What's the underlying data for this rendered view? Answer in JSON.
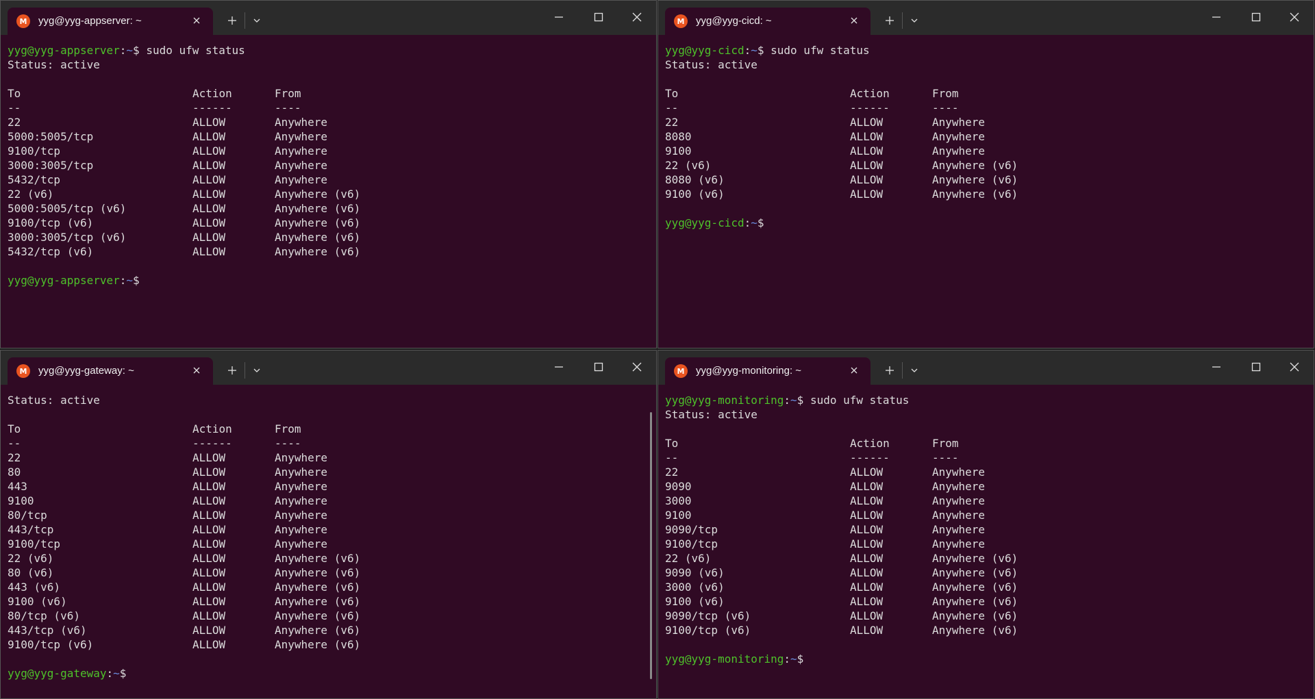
{
  "windows": [
    {
      "tab_title": "yyg@yyg-appserver: ~",
      "host": "yyg-appserver",
      "command": "sudo ufw status",
      "status_line": "Status: active",
      "rules": [
        [
          "22",
          "ALLOW",
          "Anywhere"
        ],
        [
          "5000:5005/tcp",
          "ALLOW",
          "Anywhere"
        ],
        [
          "9100/tcp",
          "ALLOW",
          "Anywhere"
        ],
        [
          "3000:3005/tcp",
          "ALLOW",
          "Anywhere"
        ],
        [
          "5432/tcp",
          "ALLOW",
          "Anywhere"
        ],
        [
          "22 (v6)",
          "ALLOW",
          "Anywhere (v6)"
        ],
        [
          "5000:5005/tcp (v6)",
          "ALLOW",
          "Anywhere (v6)"
        ],
        [
          "9100/tcp (v6)",
          "ALLOW",
          "Anywhere (v6)"
        ],
        [
          "3000:3005/tcp (v6)",
          "ALLOW",
          "Anywhere (v6)"
        ],
        [
          "5432/tcp (v6)",
          "ALLOW",
          "Anywhere (v6)"
        ]
      ]
    },
    {
      "tab_title": "yyg@yyg-cicd: ~",
      "host": "yyg-cicd",
      "command": "sudo ufw status",
      "status_line": "Status: active",
      "rules": [
        [
          "22",
          "ALLOW",
          "Anywhere"
        ],
        [
          "8080",
          "ALLOW",
          "Anywhere"
        ],
        [
          "9100",
          "ALLOW",
          "Anywhere"
        ],
        [
          "22 (v6)",
          "ALLOW",
          "Anywhere (v6)"
        ],
        [
          "8080 (v6)",
          "ALLOW",
          "Anywhere (v6)"
        ],
        [
          "9100 (v6)",
          "ALLOW",
          "Anywhere (v6)"
        ]
      ]
    },
    {
      "tab_title": "yyg@yyg-gateway: ~",
      "host": "yyg-gateway",
      "command": "",
      "status_line": "Status: active",
      "rules": [
        [
          "22",
          "ALLOW",
          "Anywhere"
        ],
        [
          "80",
          "ALLOW",
          "Anywhere"
        ],
        [
          "443",
          "ALLOW",
          "Anywhere"
        ],
        [
          "9100",
          "ALLOW",
          "Anywhere"
        ],
        [
          "80/tcp",
          "ALLOW",
          "Anywhere"
        ],
        [
          "443/tcp",
          "ALLOW",
          "Anywhere"
        ],
        [
          "9100/tcp",
          "ALLOW",
          "Anywhere"
        ],
        [
          "22 (v6)",
          "ALLOW",
          "Anywhere (v6)"
        ],
        [
          "80 (v6)",
          "ALLOW",
          "Anywhere (v6)"
        ],
        [
          "443 (v6)",
          "ALLOW",
          "Anywhere (v6)"
        ],
        [
          "9100 (v6)",
          "ALLOW",
          "Anywhere (v6)"
        ],
        [
          "80/tcp (v6)",
          "ALLOW",
          "Anywhere (v6)"
        ],
        [
          "443/tcp (v6)",
          "ALLOW",
          "Anywhere (v6)"
        ],
        [
          "9100/tcp (v6)",
          "ALLOW",
          "Anywhere (v6)"
        ]
      ]
    },
    {
      "tab_title": "yyg@yyg-monitoring: ~",
      "host": "yyg-monitoring",
      "command": "sudo ufw status",
      "status_line": "Status: active",
      "rules": [
        [
          "22",
          "ALLOW",
          "Anywhere"
        ],
        [
          "9090",
          "ALLOW",
          "Anywhere"
        ],
        [
          "3000",
          "ALLOW",
          "Anywhere"
        ],
        [
          "9100",
          "ALLOW",
          "Anywhere"
        ],
        [
          "9090/tcp",
          "ALLOW",
          "Anywhere"
        ],
        [
          "9100/tcp",
          "ALLOW",
          "Anywhere"
        ],
        [
          "22 (v6)",
          "ALLOW",
          "Anywhere (v6)"
        ],
        [
          "9090 (v6)",
          "ALLOW",
          "Anywhere (v6)"
        ],
        [
          "3000 (v6)",
          "ALLOW",
          "Anywhere (v6)"
        ],
        [
          "9100 (v6)",
          "ALLOW",
          "Anywhere (v6)"
        ],
        [
          "9090/tcp (v6)",
          "ALLOW",
          "Anywhere (v6)"
        ],
        [
          "9100/tcp (v6)",
          "ALLOW",
          "Anywhere (v6)"
        ]
      ]
    }
  ],
  "prompt": {
    "user": "yyg@",
    "sep": ":",
    "path": "~",
    "sym": "$ "
  },
  "table_headers": {
    "to": "To",
    "action": "Action",
    "from": "From"
  },
  "table_dashes": {
    "to": "--",
    "action": "------",
    "from": "----"
  },
  "tab_icon_glyph": "M",
  "colors": {
    "terminal_bg": "#300a24",
    "titlebar_bg": "#2b2b2b",
    "prompt_user": "#4ec22a",
    "prompt_path": "#6a8cde",
    "tab_icon": "#e95420"
  },
  "icons": {
    "tab_icon": "ubuntu-logo-icon",
    "tab_close": "close-icon",
    "new_tab": "plus-icon",
    "dropdown": "chevron-down-icon",
    "minimize": "minimize-icon",
    "maximize": "maximize-icon",
    "close": "close-window-icon"
  }
}
